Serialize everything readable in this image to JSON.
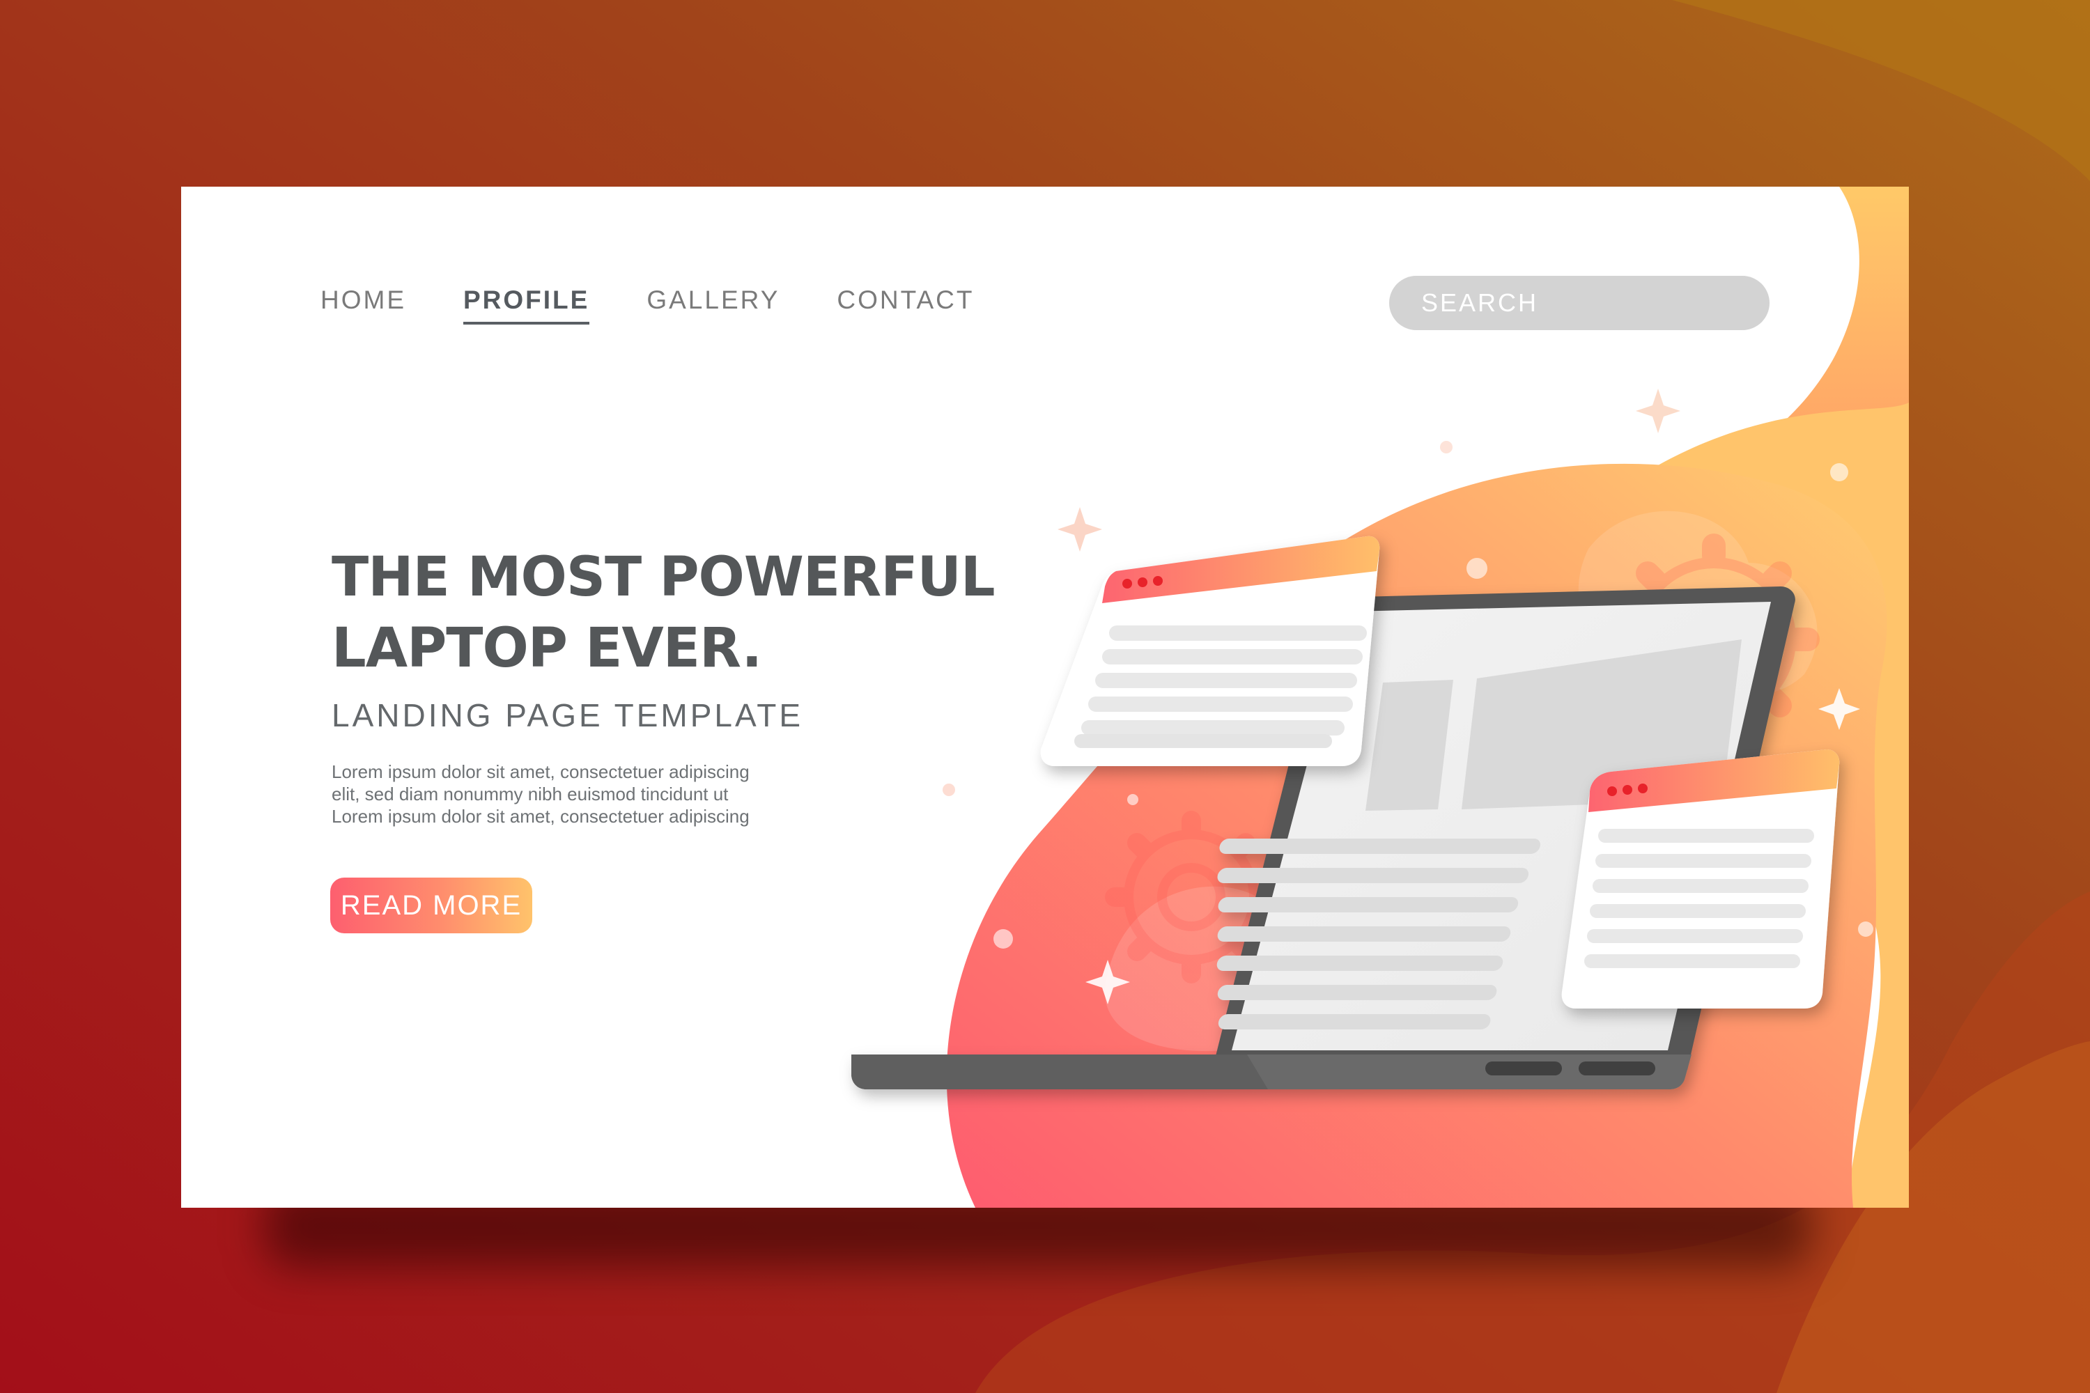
{
  "nav": {
    "items": [
      {
        "label": "HOME"
      },
      {
        "label": "PROFILE"
      },
      {
        "label": "GALLERY"
      },
      {
        "label": "CONTACT"
      }
    ],
    "active_index": 1
  },
  "search": {
    "placeholder": "SEARCH"
  },
  "hero": {
    "headline_line1": "THE MOST POWERFUL",
    "headline_line2": "LAPTOP EVER.",
    "subtitle": "LANDING PAGE TEMPLATE",
    "body_lines": [
      "Lorem ipsum dolor sit amet, consectetuer adipiscing",
      "elit, sed diam nonummy nibh euismod tincidunt ut",
      "Lorem ipsum dolor sit amet, consectetuer adipiscing"
    ],
    "cta_label": "READ MORE"
  },
  "colors": {
    "gradient_start": "#fd5f6f",
    "gradient_mid": "#ff8d6d",
    "gradient_end": "#ffc36b",
    "heading_text": "#545759",
    "nav_text": "#7a7a7a",
    "search_bg": "#d3d3d3",
    "laptop_body": "#6b6b6b",
    "page_background": "#a3271a"
  },
  "icons": [
    "gear-icon",
    "sparkle-icon",
    "window-dots-icon"
  ]
}
